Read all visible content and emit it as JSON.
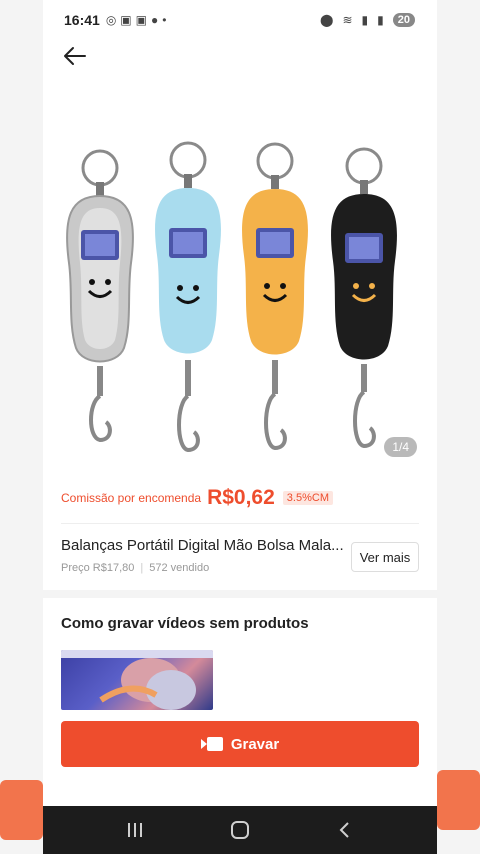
{
  "status_bar": {
    "time": "16:41",
    "battery": "20"
  },
  "product": {
    "image_counter": "1/4",
    "commission_label": "Comissão por encomenda",
    "commission_value": "R$0,62",
    "commission_rate": "3.5%CM",
    "title": "Balanças Portátil Digital Mão Bolsa Mala...",
    "price": "Preço R$17,80",
    "sold": "572 vendido",
    "more_button": "Ver mais"
  },
  "video_section": {
    "heading": "Como gravar vídeos sem produtos"
  },
  "record_button": {
    "label": "Gravar"
  },
  "icons": {
    "back": "arrow-left-icon",
    "record": "video-camera-icon",
    "nav_recent": "recent-apps-icon",
    "nav_home": "home-icon",
    "nav_back": "back-icon"
  },
  "colors": {
    "accent": "#ee4d2d",
    "scale_colors": [
      "#c9c9c9",
      "#a9dcee",
      "#f4b24a",
      "#1d1d1d"
    ]
  }
}
